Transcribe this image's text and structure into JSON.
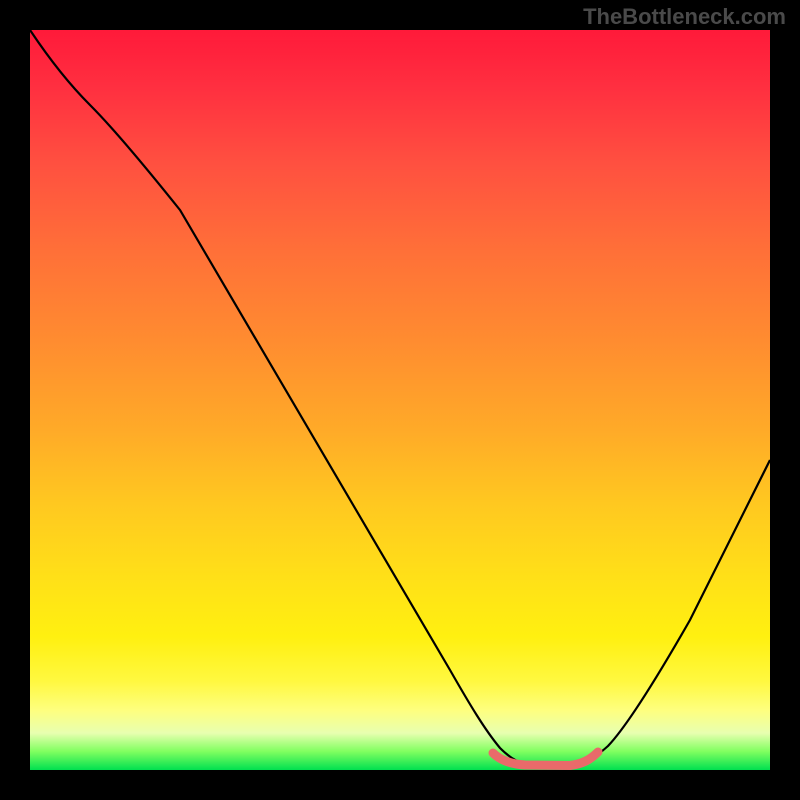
{
  "watermark": "TheBottleneck.com",
  "chart_data": {
    "type": "line",
    "title": "",
    "xlabel": "",
    "ylabel": "",
    "xlim": [
      0,
      100
    ],
    "ylim": [
      0,
      100
    ],
    "series": [
      {
        "name": "bottleneck-curve",
        "x": [
          0,
          3,
          8,
          15,
          25,
          35,
          45,
          55,
          60,
          62,
          65,
          70,
          73,
          75,
          80,
          88,
          95,
          100
        ],
        "y": [
          100,
          96,
          92,
          85,
          73,
          60,
          47,
          33,
          22,
          14,
          7,
          2,
          0.5,
          0.5,
          3,
          15,
          30,
          44
        ]
      },
      {
        "name": "optimal-zone",
        "x": [
          62,
          65,
          68,
          72,
          75
        ],
        "y": [
          1.5,
          0.8,
          0.5,
          0.6,
          1.2
        ]
      }
    ],
    "gradient_stops": [
      {
        "pos": 0,
        "color": "#ff1a3a"
      },
      {
        "pos": 50,
        "color": "#ffaa28"
      },
      {
        "pos": 85,
        "color": "#fff010"
      },
      {
        "pos": 100,
        "color": "#00e050"
      }
    ],
    "optimal_marker_color": "#e96a6a"
  }
}
